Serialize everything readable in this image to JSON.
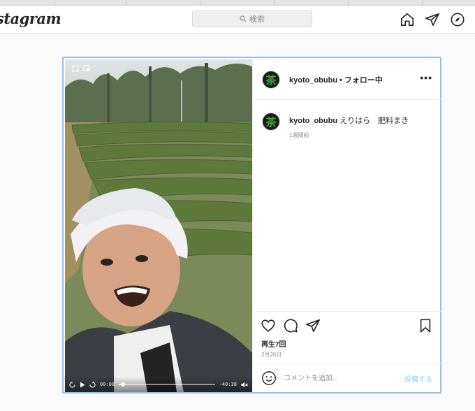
{
  "header": {
    "logo_text": "stagram",
    "search_placeholder": "検索",
    "icons": [
      "home-icon",
      "direct-message-icon",
      "explore-compass-icon"
    ]
  },
  "post": {
    "username": "kyoto_obubu",
    "separator": "•",
    "follow_status": "フォロー中",
    "more_label": "•••",
    "avatar_glyph": "茶",
    "caption": {
      "username": "kyoto_obubu",
      "text": "えりはら　肥料まき",
      "time_ago": "1週間前"
    },
    "video": {
      "current_time": "00:08",
      "remaining_time": "-40:38",
      "progress": 0.04
    },
    "plays_text": "再生7回",
    "date": "2月26日",
    "comment": {
      "placeholder": "コメントを追加...",
      "submit_label": "投稿する"
    }
  },
  "colors": {
    "accent_blue_disabled": "#b2dffc",
    "card_highlight": "#9cc0ea",
    "avatar_tea_green": "#3fa03a"
  }
}
